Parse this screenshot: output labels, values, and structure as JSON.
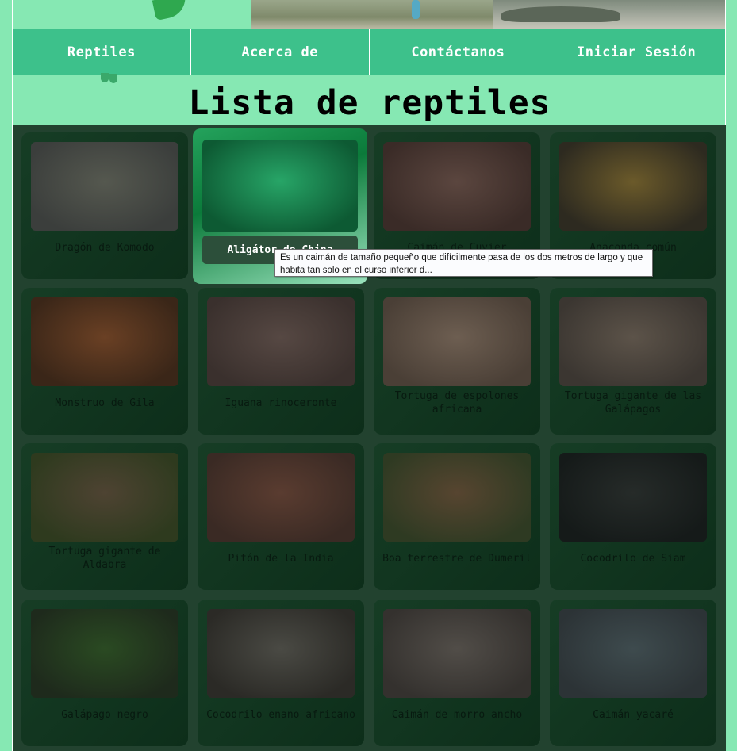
{
  "nav": {
    "items": [
      "Reptiles",
      "Acerca de",
      "Contáctanos",
      "Iniciar Sesión"
    ]
  },
  "page": {
    "title": "Lista de reptiles"
  },
  "reptiles": [
    {
      "name": "Dragón de Komodo",
      "colors": [
        "#3b3e3c",
        "#55584f"
      ]
    },
    {
      "name": "Aligátor de China",
      "colors": [
        "#0d5a33",
        "#27a567"
      ],
      "hovered": true
    },
    {
      "name": "Caimán de Cuvier",
      "colors": [
        "#3a2b27",
        "#5b463f"
      ]
    },
    {
      "name": "Anaconda común",
      "colors": [
        "#2d2a20",
        "#6b5a2a"
      ]
    },
    {
      "name": "Monstruo de Gila",
      "colors": [
        "#3a2618",
        "#6a4024"
      ]
    },
    {
      "name": "Iguana rinoceronte",
      "colors": [
        "#3a302d",
        "#564843"
      ]
    },
    {
      "name": "Tortuga de espolones africana",
      "colors": [
        "#4a3f36",
        "#6d5e51"
      ]
    },
    {
      "name": "Tortuga gigante de las Galápagos",
      "colors": [
        "#3b3631",
        "#5c5349"
      ]
    },
    {
      "name": "Tortuga gigante de Aldabra",
      "colors": [
        "#2e3a1e",
        "#4e4332"
      ]
    },
    {
      "name": "Pitón de la India",
      "colors": [
        "#3a2a24",
        "#5a3c30"
      ]
    },
    {
      "name": "Boa terrestre de Dumeril",
      "colors": [
        "#2e3a22",
        "#574530"
      ]
    },
    {
      "name": "Cocodrilo de Siam",
      "colors": [
        "#151a19",
        "#262b29"
      ]
    },
    {
      "name": "Galápago negro",
      "colors": [
        "#1e2a1c",
        "#2a4a22"
      ]
    },
    {
      "name": "Cocodrilo enano africano",
      "colors": [
        "#2b2a26",
        "#4a4a44"
      ]
    },
    {
      "name": "Caimán de morro ancho",
      "colors": [
        "#34312e",
        "#514d48"
      ]
    },
    {
      "name": "Caimán yacaré",
      "colors": [
        "#2c3336",
        "#3e4b4e"
      ]
    }
  ],
  "tooltip": {
    "text": "Es un caimán de tamaño pequeño que difícilmente pasa de los dos metros de largo y que habita tan solo en el curso inferior d..."
  }
}
